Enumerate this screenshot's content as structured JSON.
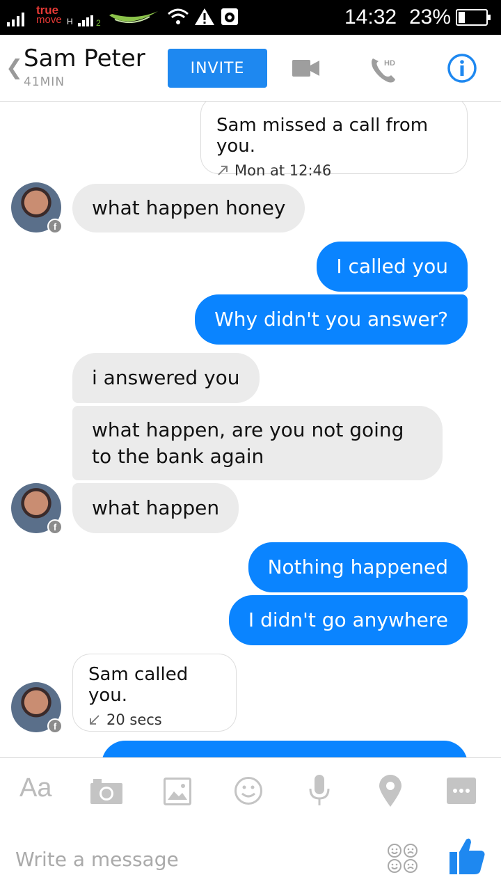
{
  "status_bar": {
    "carrier_line1": "true",
    "carrier_line2": "move",
    "network_type": "H",
    "sim2_label": "2",
    "time": "14:32",
    "battery_percent_text": "23%",
    "battery_level": 0.23
  },
  "header": {
    "back_icon": "chevron-left-icon",
    "contact_name": "Sam Peter",
    "contact_status": "41MIN",
    "invite_label": "INVITE",
    "video_icon": "video-camera-icon",
    "call_icon": "hd-phone-icon",
    "call_badge": "HD",
    "info_icon": "info-icon",
    "accent": "#1e88f0"
  },
  "messages": {
    "m1_call_title": "Sam missed a call from you.",
    "m1_call_sub": "Mon at 12:46",
    "m2": "what happen honey",
    "m3": "I called you",
    "m4": "Why didn't you answer?",
    "m5": "i answered you",
    "m6_line1": "what happen, are you not going",
    "m6_line2": "to the bank again",
    "m7": "what happen",
    "m8": "Nothing happened",
    "m9": "I didn't go anywhere",
    "m10_call_title": "Sam called you.",
    "m10_call_sub": "20 secs",
    "outgoing_color": "#0a84ff",
    "incoming_color": "#ebebeb"
  },
  "toolbar": {
    "text_toggle": "Aa",
    "icons": [
      "camera-icon",
      "gallery-icon",
      "emoji-icon",
      "microphone-icon",
      "location-icon",
      "more-icon"
    ]
  },
  "composer": {
    "placeholder": "Write a message",
    "sticker_icon": "sticker-icon",
    "like_icon": "thumbs-up-icon"
  }
}
